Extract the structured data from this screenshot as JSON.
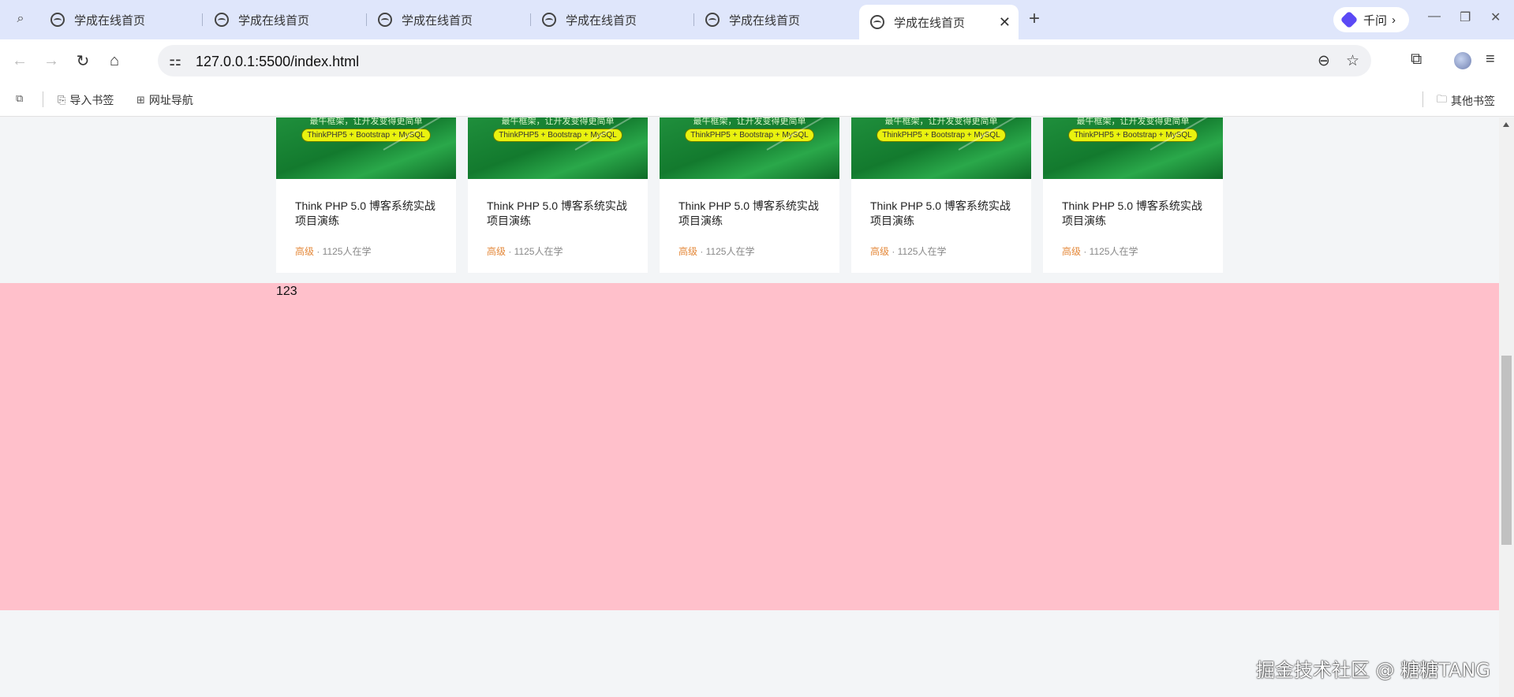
{
  "browser": {
    "tabs": [
      {
        "title": "学成在线首页",
        "active": false
      },
      {
        "title": "学成在线首页",
        "active": false
      },
      {
        "title": "学成在线首页",
        "active": false
      },
      {
        "title": "学成在线首页",
        "active": false
      },
      {
        "title": "学成在线首页",
        "active": false
      },
      {
        "title": "学成在线首页",
        "active": true
      }
    ],
    "close_glyph": "✕",
    "new_tab_glyph": "+",
    "qianwen_label": "千问",
    "qianwen_chevron": "›",
    "address": "127.0.0.1:5500/index.html",
    "window_controls": {
      "minimize": "—",
      "restore": "❐",
      "close": "✕"
    }
  },
  "bookmarks": {
    "import_label": "导入书签",
    "nav_label": "网址导航",
    "other_label": "其他书签"
  },
  "icons": {
    "back": "back-arrow-icon",
    "forward": "forward-arrow-icon",
    "reload": "reload-icon",
    "home": "home-icon",
    "site_info": "site-info-icon",
    "zoom": "zoom-out-icon",
    "star": "bookmark-star-icon",
    "extensions": "extensions-icon",
    "menu": "menu-icon"
  },
  "page": {
    "cards": [
      {
        "slogan": "最牛框架，让开发变得更简单",
        "tag": "ThinkPHP5 + Bootstrap + MySQL",
        "title": "Think PHP 5.0 博客系统实战项目演练",
        "level": "高级",
        "learners": " · 1125人在学"
      },
      {
        "slogan": "最牛框架，让开发变得更简单",
        "tag": "ThinkPHP5 + Bootstrap + MySQL",
        "title": "Think PHP 5.0 博客系统实战项目演练",
        "level": "高级",
        "learners": " · 1125人在学"
      },
      {
        "slogan": "最牛框架，让开发变得更简单",
        "tag": "ThinkPHP5 + Bootstrap + MySQL",
        "title": "Think PHP 5.0 博客系统实战项目演练",
        "level": "高级",
        "learners": " · 1125人在学"
      },
      {
        "slogan": "最牛框架，让开发变得更简单",
        "tag": "ThinkPHP5 + Bootstrap + MySQL",
        "title": "Think PHP 5.0 博客系统实战项目演练",
        "level": "高级",
        "learners": " · 1125人在学"
      },
      {
        "slogan": "最牛框架，让开发变得更简单",
        "tag": "ThinkPHP5 + Bootstrap + MySQL",
        "title": "Think PHP 5.0 博客系统实战项目演练",
        "level": "高级",
        "learners": " · 1125人在学"
      }
    ],
    "footer_text": "123",
    "footer_bg": "#ffc0cb",
    "level_color": "#e4893b"
  },
  "watermark": "掘金技术社区 @ 糖糖TANG"
}
